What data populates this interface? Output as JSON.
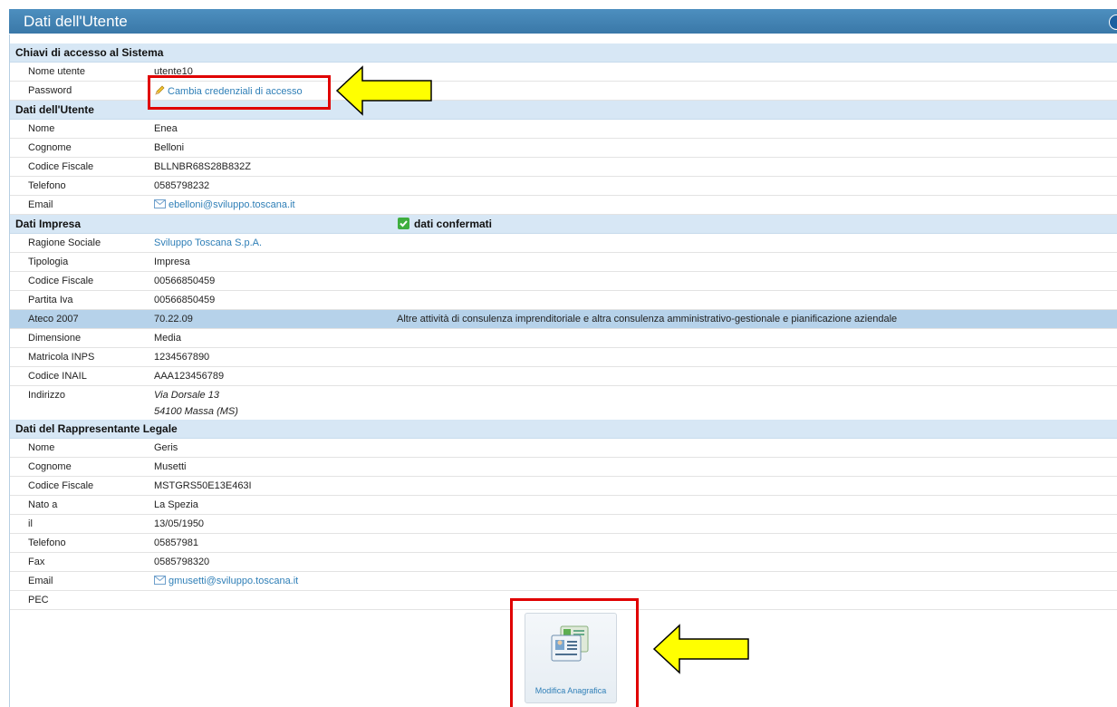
{
  "window": {
    "title": "Dati dell'Utente"
  },
  "sections": {
    "access": {
      "title": "Chiavi di accesso al Sistema",
      "username_label": "Nome utente",
      "username_value": "utente10",
      "password_label": "Password",
      "password_link": "Cambia credenziali di accesso"
    },
    "user": {
      "title": "Dati dell'Utente",
      "nome_label": "Nome",
      "nome_value": "Enea",
      "cognome_label": "Cognome",
      "cognome_value": "Belloni",
      "cf_label": "Codice Fiscale",
      "cf_value": "BLLNBR68S28B832Z",
      "tel_label": "Telefono",
      "tel_value": "0585798232",
      "email_label": "Email",
      "email_value": "ebelloni@sviluppo.toscana.it"
    },
    "company": {
      "title": "Dati Impresa",
      "status": "dati confermati",
      "ragione_label": "Ragione Sociale",
      "ragione_value": "Sviluppo Toscana S.p.A.",
      "tipologia_label": "Tipologia",
      "tipologia_value": "Impresa",
      "cf_label": "Codice Fiscale",
      "cf_value": "00566850459",
      "piva_label": "Partita Iva",
      "piva_value": "00566850459",
      "ateco_label": "Ateco 2007",
      "ateco_value": "70.22.09",
      "ateco_desc": "Altre attività di consulenza imprenditoriale e altra consulenza amministrativo-gestionale e pianificazione aziendale",
      "dimensione_label": "Dimensione",
      "dimensione_value": "Media",
      "inps_label": "Matricola INPS",
      "inps_value": "1234567890",
      "inail_label": "Codice INAIL",
      "inail_value": "AAA123456789",
      "indirizzo_label": "Indirizzo",
      "indirizzo_line1": "Via Dorsale 13",
      "indirizzo_line2": "54100 Massa (MS)"
    },
    "legal": {
      "title": "Dati del Rappresentante Legale",
      "nome_label": "Nome",
      "nome_value": "Geris",
      "cognome_label": "Cognome",
      "cognome_value": "Musetti",
      "cf_label": "Codice Fiscale",
      "cf_value": "MSTGRS50E13E463I",
      "nato_label": "Nato a",
      "nato_value": "La Spezia",
      "il_label": "il",
      "il_value": "13/05/1950",
      "tel_label": "Telefono",
      "tel_value": "05857981",
      "fax_label": "Fax",
      "fax_value": "0585798320",
      "email_label": "Email",
      "email_value": "gmusetti@sviluppo.toscana.it",
      "pec_label": "PEC"
    }
  },
  "actions": {
    "modify_label": "Modifica Anagrafica"
  },
  "colors": {
    "title_bar": "#4d8fbf",
    "section_bg": "#d7e7f5",
    "highlight_row": "#b6d2ea",
    "link": "#2f7fb7",
    "annotation_red": "#e00000",
    "annotation_arrow": "#ffff00"
  }
}
